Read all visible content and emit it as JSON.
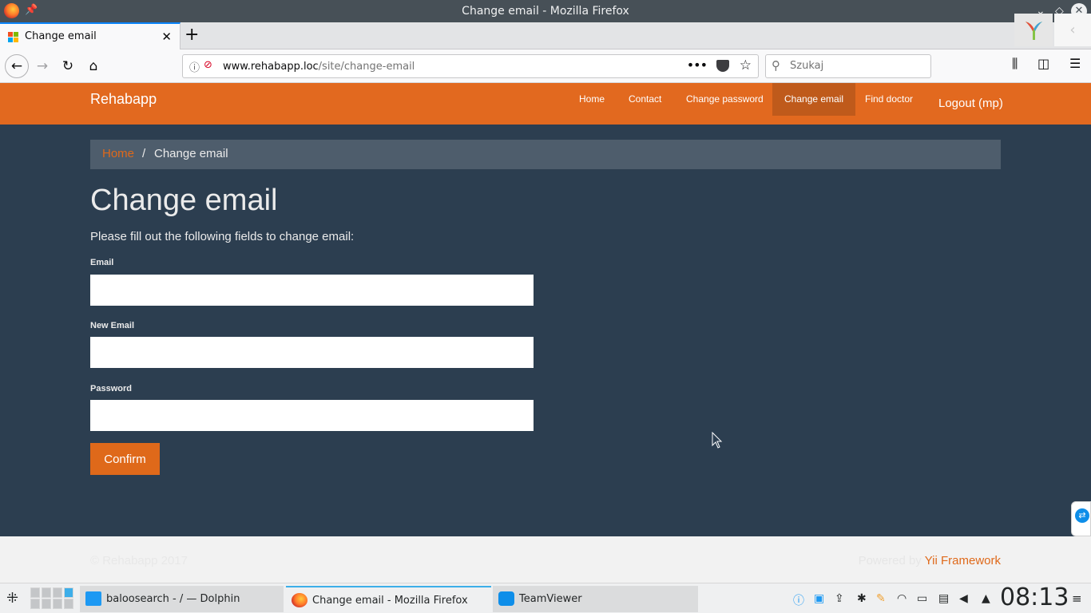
{
  "window": {
    "title": "Change email - Mozilla Firefox"
  },
  "browser": {
    "tab_title": "Change email",
    "url_host": "www.rehabapp.loc",
    "url_path": "/site/change-email",
    "search_placeholder": "Szukaj"
  },
  "site": {
    "brand": "Rehabapp",
    "nav": [
      {
        "label": "Home"
      },
      {
        "label": "Contact"
      },
      {
        "label": "Change password"
      },
      {
        "label": "Change email",
        "active": true
      },
      {
        "label": "Find doctor"
      }
    ],
    "logout": "Logout (mp)"
  },
  "breadcrumb": {
    "home": "Home",
    "separator": "/",
    "current": "Change email"
  },
  "page": {
    "title": "Change email",
    "intro": "Please fill out the following fields to change email:",
    "fields": [
      {
        "label": "Email",
        "value": ""
      },
      {
        "label": "New Email",
        "value": ""
      },
      {
        "label": "Password",
        "value": ""
      }
    ],
    "confirm_label": "Confirm"
  },
  "footer": {
    "copyright": "© Rehabapp 2017",
    "powered_by": "Powered by",
    "framework_link": "Yii Framework"
  },
  "taskbar": {
    "tasks": [
      {
        "label": "baloosearch - / — Dolphin",
        "icon": "folder-icon"
      },
      {
        "label": "Change email - Mozilla Firefox",
        "icon": "firefox-icon",
        "active": true
      },
      {
        "label": "TeamViewer",
        "icon": "teamviewer-icon"
      }
    ],
    "clock": "08:13"
  },
  "colors": {
    "site_header": "#e2691f",
    "body_bg": "#2c3e50",
    "accent": "#df691a",
    "breadcrumb_bg": "#4e5d6c"
  }
}
